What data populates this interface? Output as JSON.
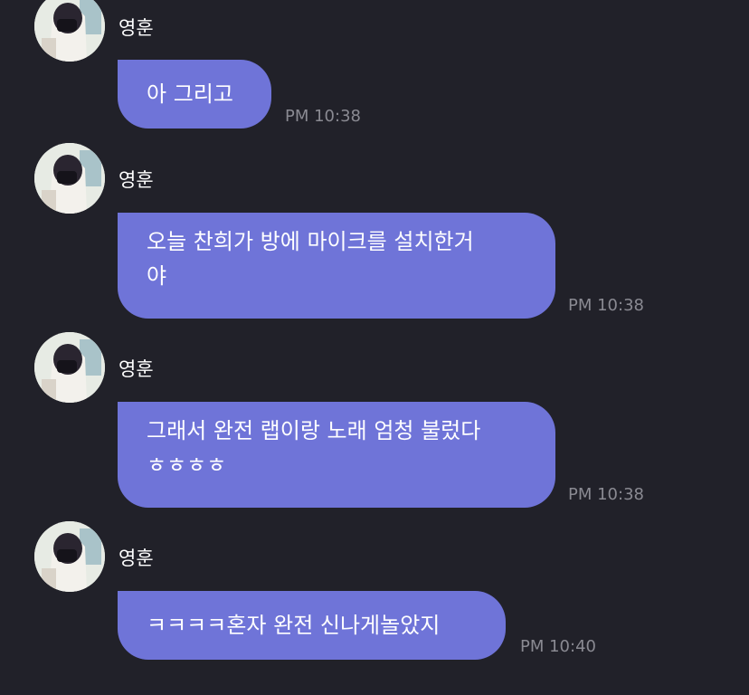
{
  "messages": [
    {
      "sender": "영훈",
      "text": "아 그리고",
      "time": "PM 10:38"
    },
    {
      "sender": "영훈",
      "text": "오늘 찬희가 방에 마이크를 설치한거\n야",
      "time": "PM 10:38"
    },
    {
      "sender": "영훈",
      "text": "그래서 완전 랩이랑 노래 엄청 불렀다\nㅎㅎㅎㅎ",
      "time": "PM 10:38"
    },
    {
      "sender": "영훈",
      "text": "ㅋㅋㅋㅋ혼자 완전 신나게놀았지",
      "time": "PM 10:40"
    }
  ],
  "colors": {
    "background": "#212129",
    "bubble": "#6f74d8",
    "time_text": "#8a8a92"
  }
}
